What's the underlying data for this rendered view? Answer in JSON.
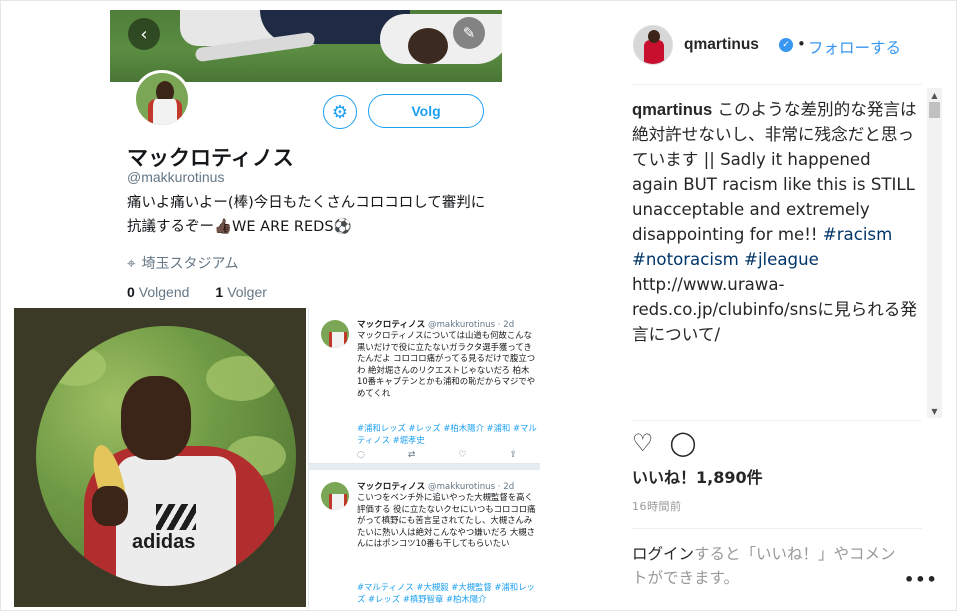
{
  "twitter_profile": {
    "follow_label": "Volg",
    "display_name": "マックロティノス",
    "handle": "@makkurotinus",
    "bio": "痛いよ痛いよー(棒)今日もたくさんコロコロして審判に抗議するぞー👍🏿WE ARE REDS⚽",
    "location": "埼玉スタジアム",
    "following_count": "0",
    "following_label": "Volgend",
    "followers_count": "1",
    "followers_label": "Volger"
  },
  "tweets": [
    {
      "name": "マックロティノス",
      "handle": "@makkurotinus · 2d",
      "body": "マックロティノスについては山道も何故こんな黒いだけで役に立たないガラクタ選手獲ってきたんだよ コロコロ痛がってる見るだけで腹立つわ 絶対堀さんのリクエストじゃないだろ 柏木10番キャプテンとかも浦和の恥だからマジでやめてくれ",
      "tags": "#浦和レッズ #レッズ #柏木陽介 #浦和 #マルティノス #堀孝史"
    },
    {
      "name": "マックロティノス",
      "handle": "@makkurotinus · 2d",
      "body": "こいつをベンチ外に追いやった大槻監督を高く評価する 役に立たないクセにいつもコロコロ痛がって槙野にも苦言呈されてたし、大槻さんみたいに熱い人は絶対こんなやつ嫌いだろ 大槻さんにはポンコツ10番も干してもらいたい",
      "tags": "#マルティノス #大槻毅 #大槻監督 #浦和レッズ #レッズ #槙野智章 #柏木陽介"
    }
  ],
  "instagram": {
    "username": "qmartinus",
    "follow_label": "フォローする",
    "caption_user": "qmartinus",
    "caption_text": " このような差別的な発言は絶対許せないし、非常に残念だと思っています || Sadly it happened again BUT racism like this is STILL unacceptable and extremely disappointing for me!! ",
    "tag_racism": "#racism",
    "tag_notoracism": "#notoracism",
    "tag_jleague": "#jleague",
    "caption_link": " http://www.urawa-reds.co.jp/clubinfo/snsに見られる発言について/",
    "likes": "いいね！1,890件",
    "time_ago": "16時間前",
    "login_link": "ログイン",
    "login_rest": "すると「いいね！」やコメントができます。",
    "more_label": "•••"
  },
  "icons": {
    "back": "back-arrow-icon",
    "edit": "feather-edit-icon",
    "gear": "gear-icon",
    "location": "location-pin-icon",
    "verified": "verified-badge-icon",
    "like": "heart-icon",
    "comment": "comment-bubble-icon"
  },
  "colors": {
    "twitter_blue": "#1da1f2",
    "instagram_blue": "#3897f0",
    "hashtag": "#003569"
  }
}
